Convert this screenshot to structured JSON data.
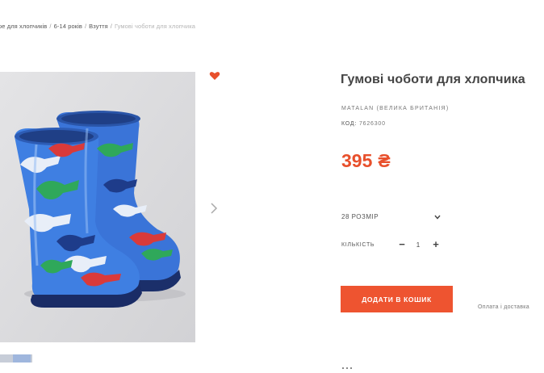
{
  "breadcrumb": {
    "items": [
      "ре для хлопчиків",
      "6-14 років",
      "Взуття"
    ],
    "current": "Гумові чоботи для хлопчика",
    "separator": "/"
  },
  "product": {
    "title": "Гумові чоботи для хлопчика",
    "brand": "MATALAN (ВЕЛИКА БРИТАНІЯ)",
    "code_label": "КОД:",
    "code_value": "7626300",
    "price": "395",
    "currency": "₴"
  },
  "options": {
    "size_selected": "28 РОЗМІР",
    "quantity_label": "КІЛЬКІСТЬ",
    "quantity_value": "1",
    "minus_label": "−",
    "plus_label": "+"
  },
  "actions": {
    "add_to_cart_label": "ДОДАТИ В КОШИК",
    "payment_link": "Оплата і доставка"
  },
  "icons": {
    "favorite": "heart-icon",
    "next": "chevron-right-icon",
    "size_dropdown": "chevron-down-icon"
  },
  "colors": {
    "accent": "#ee5430",
    "price": "#e8502c",
    "boot_blue": "#2f6fd6"
  }
}
